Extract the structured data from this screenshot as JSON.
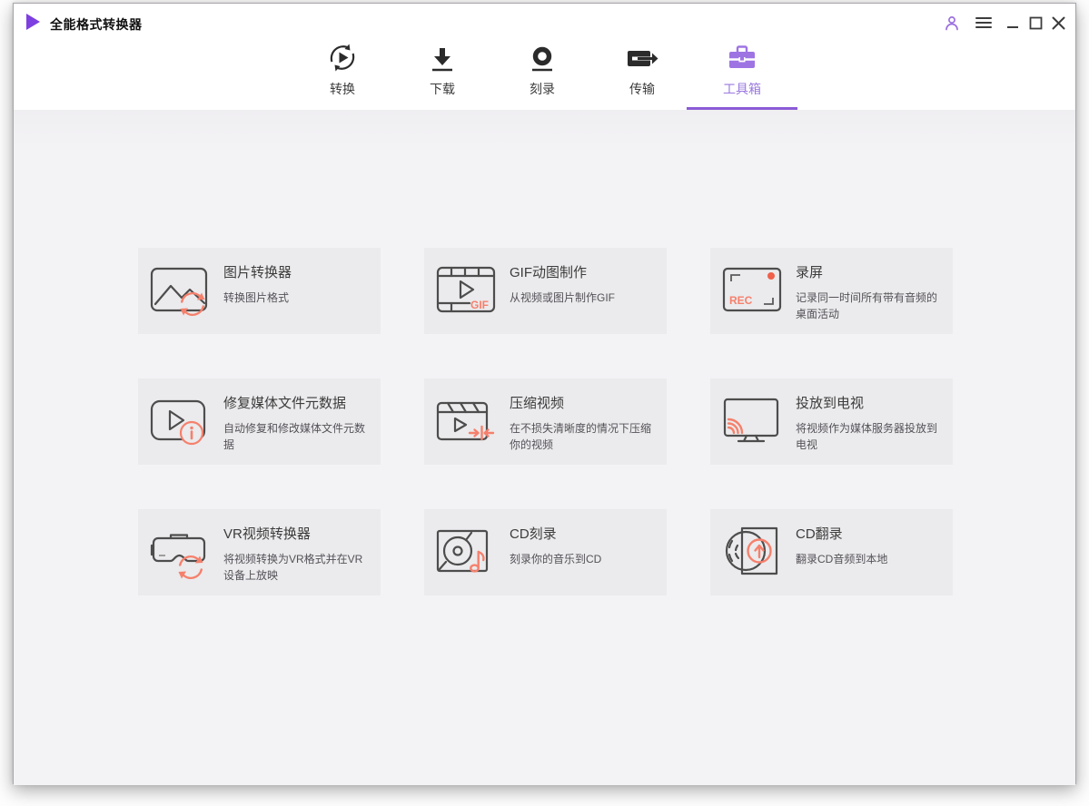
{
  "window": {
    "title": "全能格式转换器",
    "logo_icon": "play-logo-icon",
    "controls": [
      {
        "name": "account",
        "icon": "user-icon",
        "color": "#9A6FE0"
      },
      {
        "name": "menu",
        "icon": "hamburger-menu-icon"
      },
      {
        "name": "minimize",
        "icon": "minimize-icon"
      },
      {
        "name": "maximize",
        "icon": "maximize-icon"
      },
      {
        "name": "close",
        "icon": "close-icon"
      }
    ]
  },
  "nav": {
    "active_tab": "工具箱",
    "tabs": [
      {
        "label": "转换",
        "icon": "convert-icon",
        "active": false
      },
      {
        "label": "下载",
        "icon": "download-icon",
        "active": false
      },
      {
        "label": "刻录",
        "icon": "burn-icon",
        "active": false
      },
      {
        "label": "传输",
        "icon": "transfer-icon",
        "active": false
      },
      {
        "label": "工具箱",
        "icon": "toolbox-icon",
        "active": true
      }
    ]
  },
  "toolbox": {
    "cards": [
      {
        "title": "图片转换器",
        "desc": "转换图片格式",
        "icon": "image-converter-icon"
      },
      {
        "title": "GIF动图制作",
        "desc": "从视频或图片制作GIF",
        "icon": "gif-maker-icon",
        "icon_text": "GIF"
      },
      {
        "title": "录屏",
        "desc": "记录同一时间所有带有音频的桌面活动",
        "icon": "screen-recorder-icon",
        "icon_text": "REC"
      },
      {
        "title": "修复媒体文件元数据",
        "desc": "自动修复和修改媒体文件元数据",
        "icon": "fix-metadata-icon"
      },
      {
        "title": "压缩视频",
        "desc": "在不损失清晰度的情况下压缩你的视频",
        "icon": "compress-video-icon"
      },
      {
        "title": "投放到电视",
        "desc": "将视频作为媒体服务器投放到电视",
        "icon": "cast-to-tv-icon"
      },
      {
        "title": "VR视频转换器",
        "desc": "将视频转换为VR格式并在VR设备上放映",
        "icon": "vr-converter-icon"
      },
      {
        "title": "CD刻录",
        "desc": "刻录你的音乐到CD",
        "icon": "cd-burner-icon"
      },
      {
        "title": "CD翻录",
        "desc": "翻录CD音频到本地",
        "icon": "cd-ripper-icon"
      }
    ]
  },
  "colors": {
    "accent_purple": "#9A6FE0",
    "underline_purple": "#8B5BD6",
    "accent_salmon": "#F5806C",
    "record_dot": "#F0604A",
    "card_bg": "#EBEAEC",
    "content_bg": "#F2F1F4",
    "header_bg": "#FFFFFF"
  }
}
